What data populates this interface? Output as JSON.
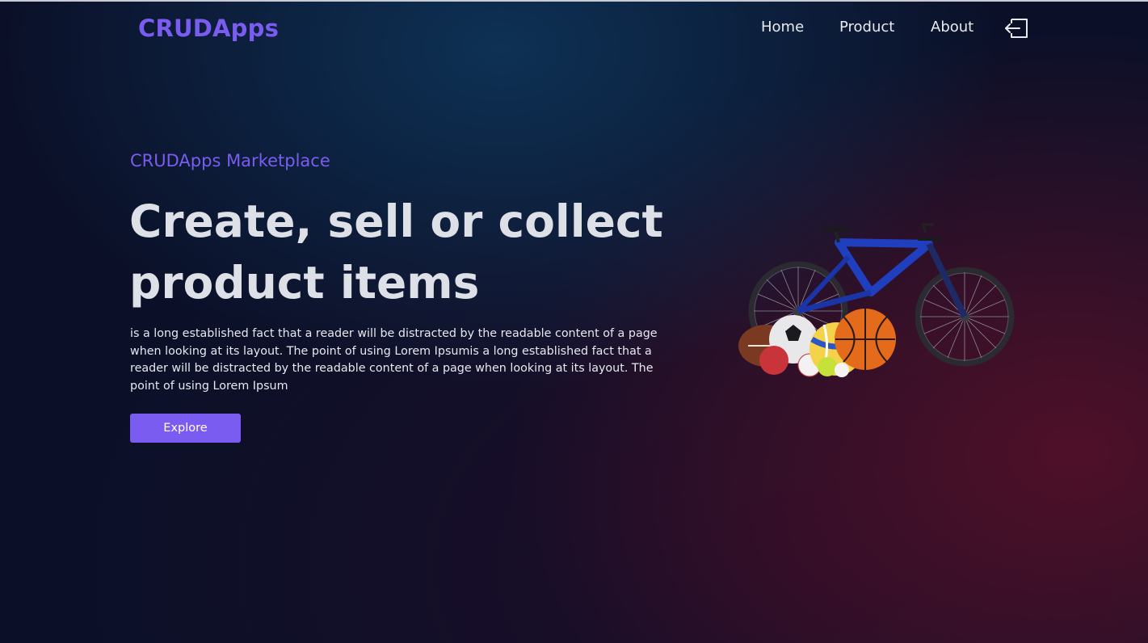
{
  "header": {
    "logo": "CRUDApps",
    "nav": [
      {
        "label": "Home"
      },
      {
        "label": "Product"
      },
      {
        "label": "About"
      }
    ],
    "logout_icon": "logout-icon"
  },
  "hero": {
    "eyebrow": "CRUDApps Marketplace",
    "headline_line1": "Create, sell or collect",
    "headline_line2": "product items",
    "description": "is a long established fact that a reader will be distracted by the readable content of a page when looking at its layout. The point of using Lorem Ipsumis a long established fact that a reader will be distracted by the readable content of a page when looking at its layout. The point of using Lorem Ipsum",
    "cta_label": "Explore"
  },
  "colors": {
    "accent": "#7b5cf0",
    "background": "#0b1028",
    "heading": "#dde0e6"
  },
  "image": {
    "subject": "bicycle-with-sports-balls"
  }
}
